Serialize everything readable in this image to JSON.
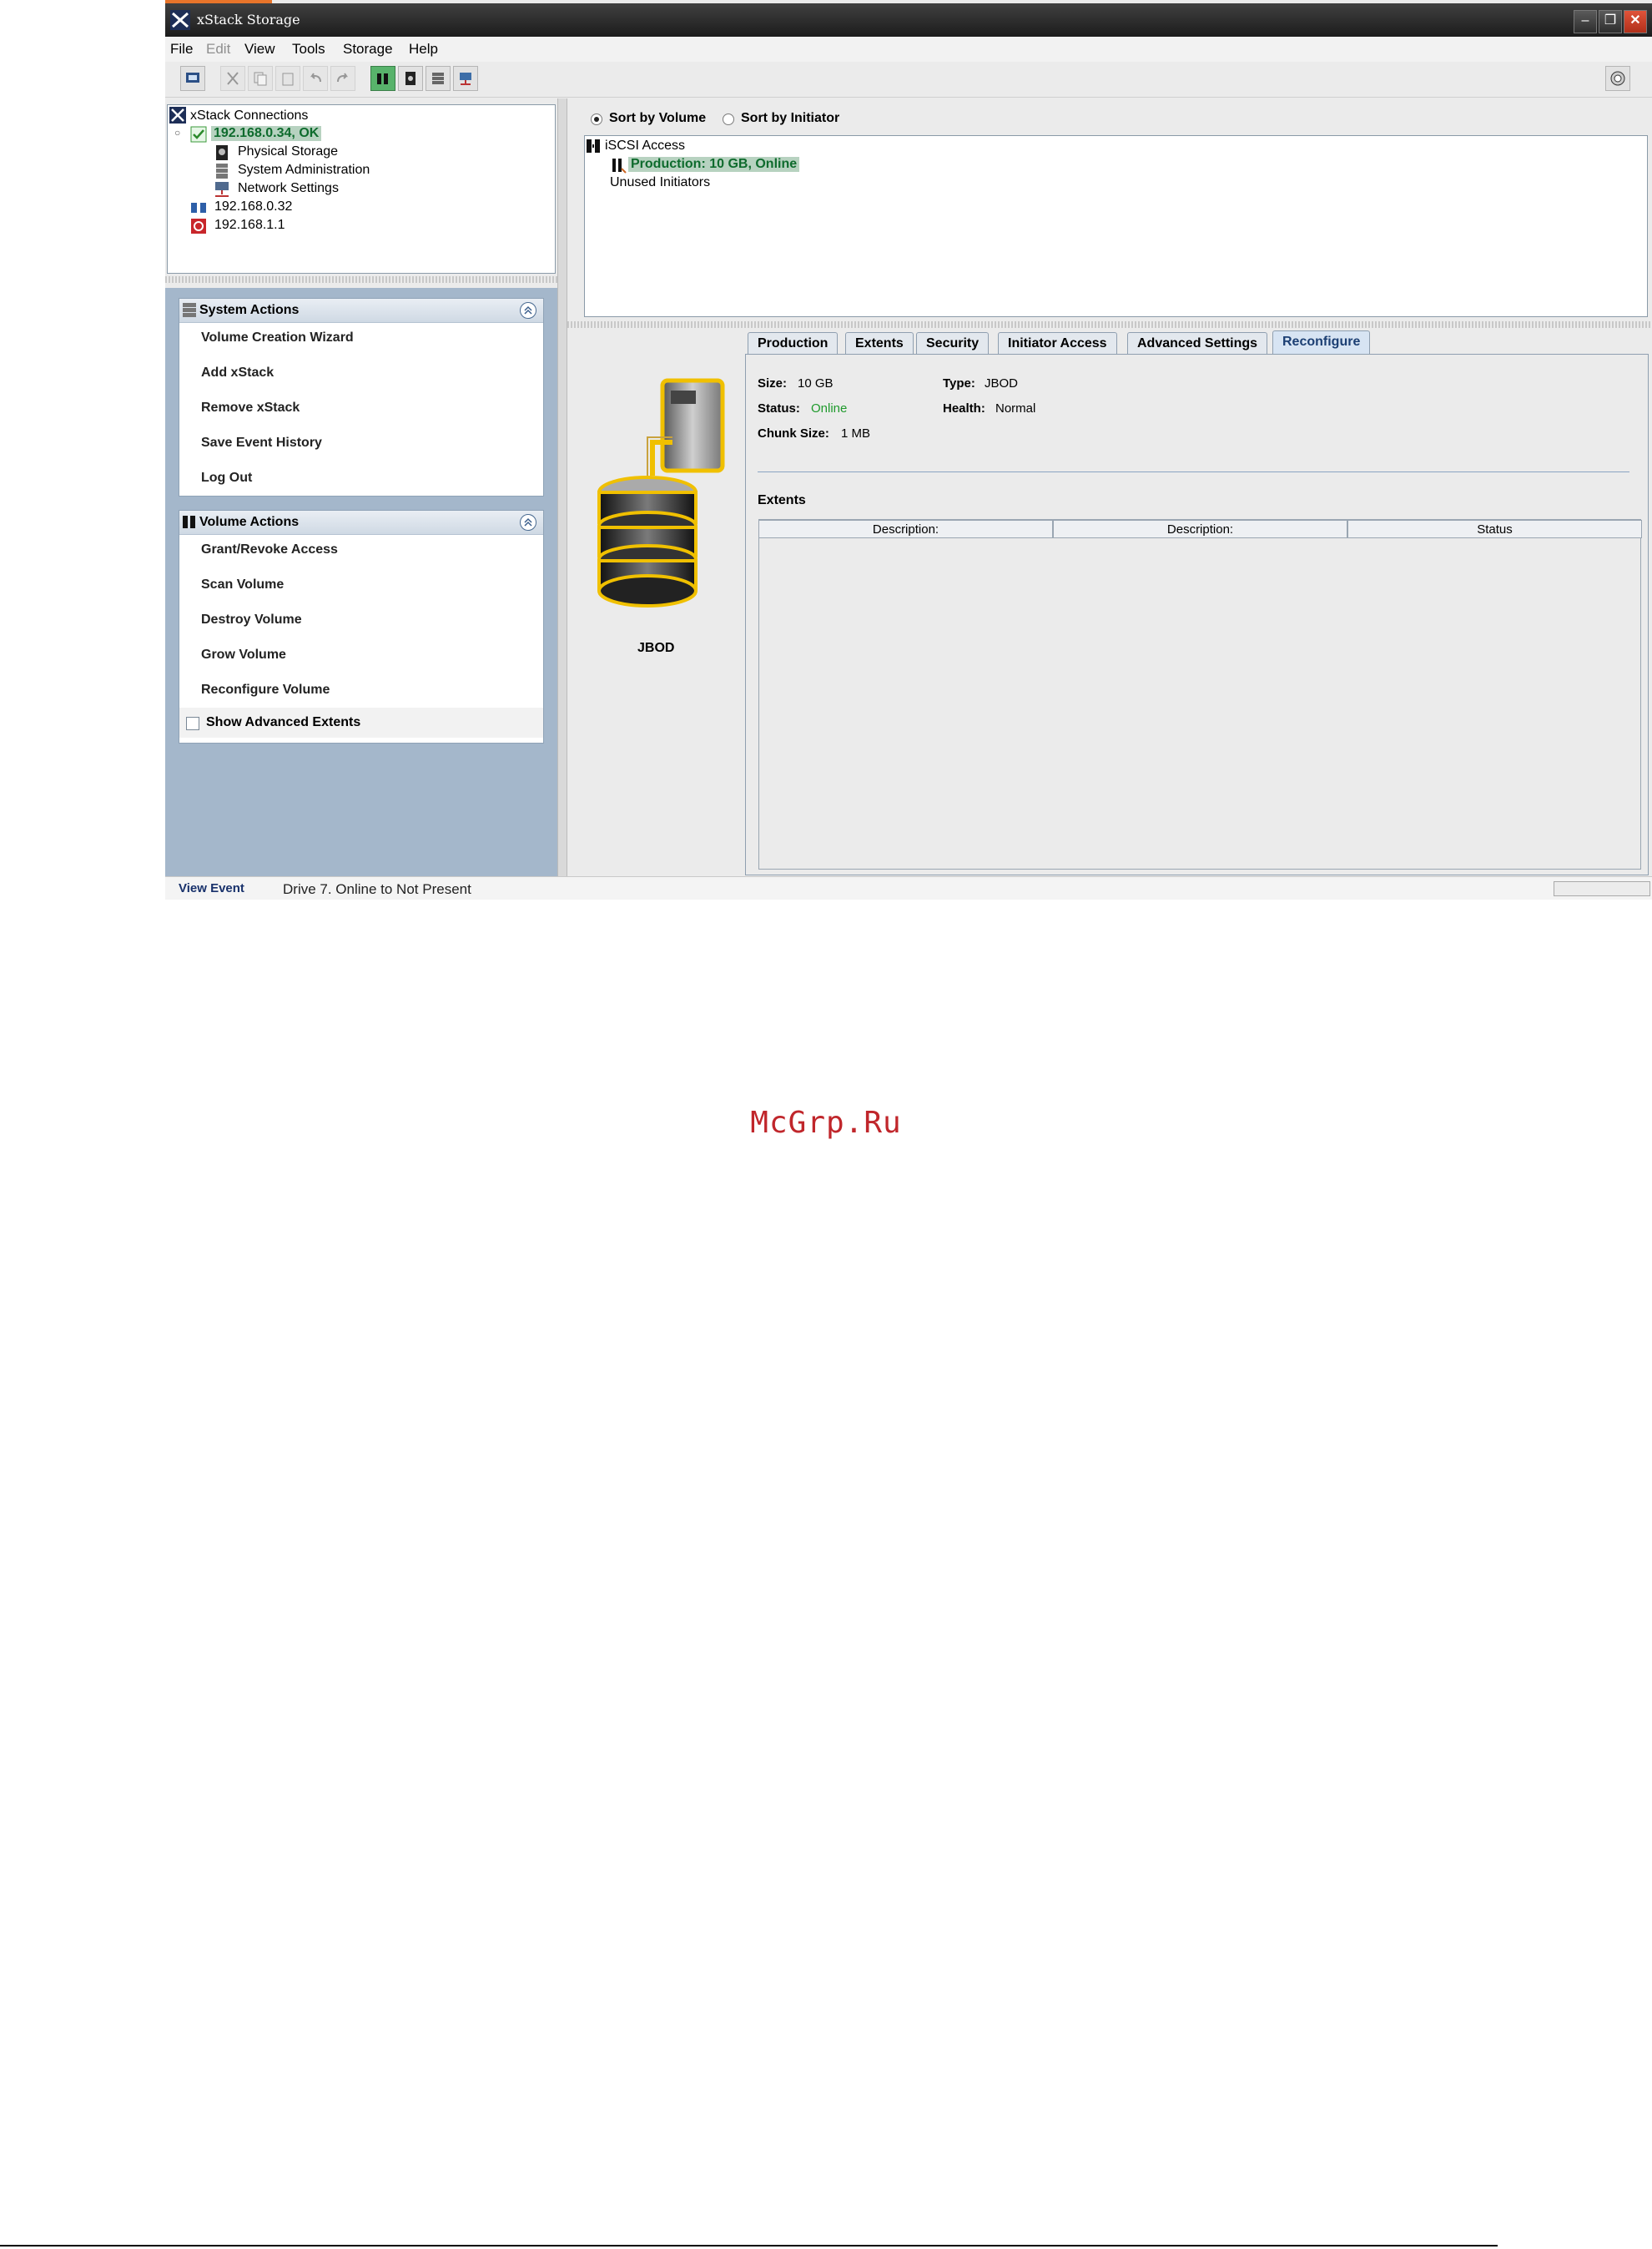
{
  "window": {
    "title": "xStack Storage"
  },
  "menu": [
    "File",
    "Edit",
    "View",
    "Tools",
    "Storage",
    "Help"
  ],
  "tree": {
    "root": "xStack Connections",
    "items": [
      {
        "label": "192.168.0.34, OK",
        "state": "selected"
      },
      {
        "label": "Physical Storage"
      },
      {
        "label": "System Administration"
      },
      {
        "label": "Network Settings"
      },
      {
        "label": "192.168.0.32"
      },
      {
        "label": "192.168.1.1"
      }
    ]
  },
  "system_actions": {
    "title": "System Actions",
    "items": [
      "Volume Creation Wizard",
      "Add xStack",
      "Remove xStack",
      "Save Event History",
      "Log Out"
    ]
  },
  "volume_actions": {
    "title": "Volume Actions",
    "items": [
      "Grant/Revoke Access",
      "Scan Volume",
      "Destroy Volume",
      "Grow Volume",
      "Reconfigure Volume"
    ],
    "checkbox_label": "Show Advanced Extents",
    "checkbox_checked": false
  },
  "sort": {
    "by_volume": "Sort by Volume",
    "by_initiator": "Sort by Initiator",
    "selected": "by_volume"
  },
  "access_tree": {
    "root": "iSCSI Access",
    "selected": "Production: 10 GB, Online",
    "other": "Unused Initiators"
  },
  "tabs": [
    "Production",
    "Extents",
    "Security",
    "Initiator Access",
    "Advanced Settings",
    "Reconfigure"
  ],
  "active_tab": "Reconfigure",
  "volume_image_label": "JBOD",
  "properties": {
    "size_label": "Size:",
    "size": "10 GB",
    "type_label": "Type:",
    "type": "JBOD",
    "status_label": "Status:",
    "status": "Online",
    "health_label": "Health:",
    "health": "Normal",
    "chunk_label": "Chunk Size:",
    "chunk": "1 MB"
  },
  "extents": {
    "title": "Extents",
    "columns": [
      "Description:",
      "Description:",
      "Status"
    ]
  },
  "statusbar": {
    "link": "View Event",
    "message": "Drive 7. Online to Not Present"
  },
  "watermark": "McGrp.Ru",
  "colors": {
    "status_online": "#1f9a2c",
    "selection": "#b7d2c0",
    "left_panel_bg": "#a4b7cb"
  }
}
